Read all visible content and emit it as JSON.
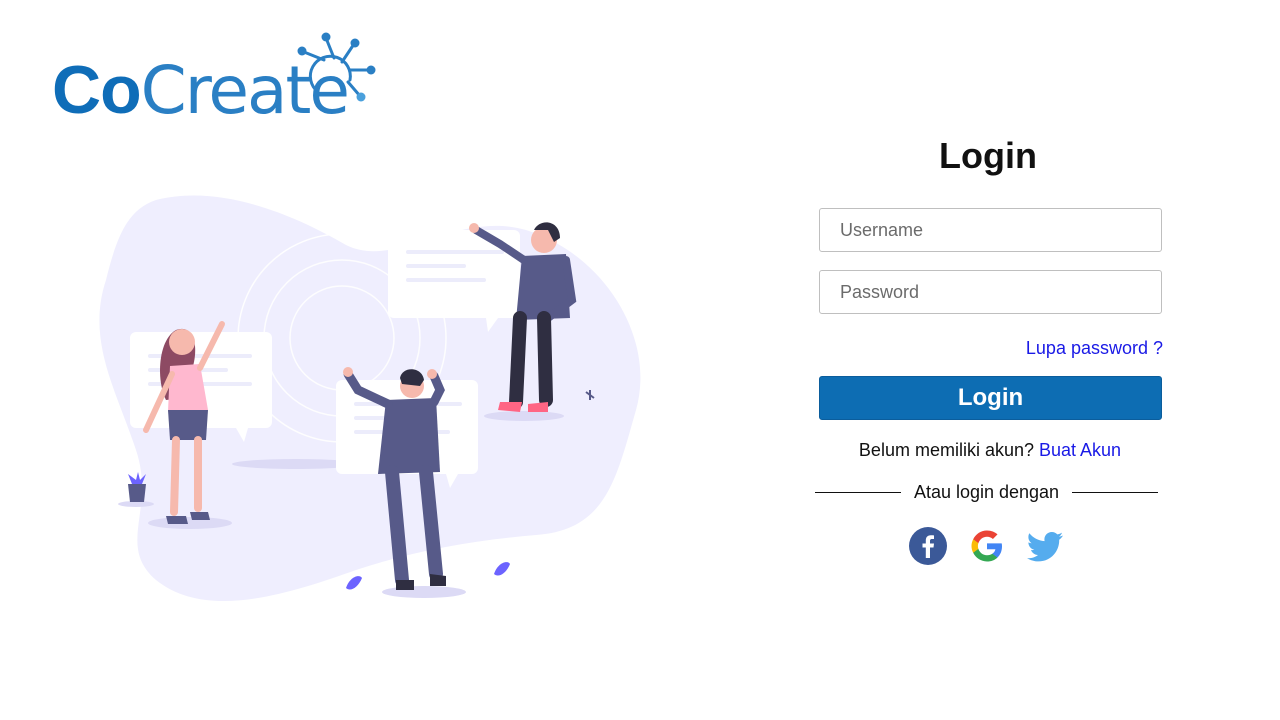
{
  "logo": {
    "text_co": "Co",
    "text_create": "Create"
  },
  "login": {
    "title": "Login",
    "username_placeholder": "Username",
    "password_placeholder": "Password",
    "forgot_label": "Lupa password ?",
    "submit_label": "Login",
    "register_prompt": "Belum memiliki akun? ",
    "register_link": "Buat Akun",
    "divider_text": "Atau login dengan"
  },
  "social": [
    {
      "icon": "facebook-icon",
      "color": "#3b5998"
    },
    {
      "icon": "google-icon",
      "color": "#4285f4"
    },
    {
      "icon": "twitter-icon",
      "color": "#55acee"
    }
  ],
  "colors": {
    "brand": "#0d6db3",
    "link": "#1a1ae6",
    "illustration_blob": "#efeefe"
  }
}
